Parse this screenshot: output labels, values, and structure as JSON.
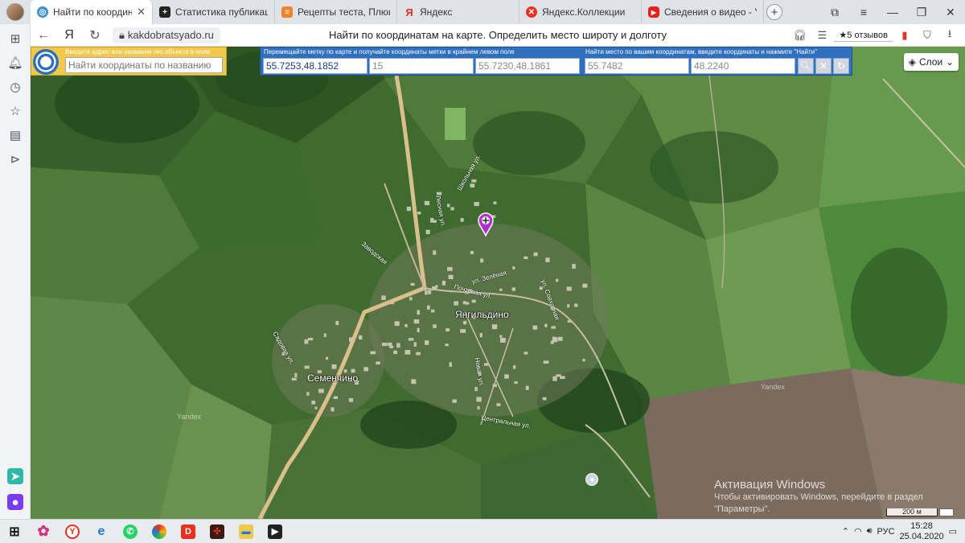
{
  "browser": {
    "tabs": [
      {
        "title": "Найти по координатам",
        "active": true,
        "favicon_color": "#3b8ed8"
      },
      {
        "title": "Статистика публикаций",
        "active": false,
        "favicon_color": "#222222"
      },
      {
        "title": "Рецепты теста, Плюшка",
        "active": false,
        "favicon_color": "#f0822a"
      },
      {
        "title": "Яндекс",
        "active": false,
        "favicon_color": "#e8321f"
      },
      {
        "title": "Яндекс.Коллекции",
        "active": false,
        "favicon_color": "#e8321f"
      },
      {
        "title": "Сведения о видео - YouT",
        "active": false,
        "favicon_color": "#e62117"
      }
    ],
    "new_tab_label": "+",
    "url": "kakdobratsyado.ru",
    "page_title": "Найти по координатам на карте. Определить место широту и долготу",
    "reviews_label": "★5 отзывов"
  },
  "search_panel": {
    "label": "Введите адрес или название гео.объекта в поле",
    "placeholder": "Найти координаты по названию"
  },
  "coord_panel": {
    "move_label": "Перемещайте метку по карте и получайте координаты метки в крайнем левом поле",
    "find_label": "Найти место по вашим координатам, введите координаты и нажмите \"Найти\"",
    "marker_coords": "55.7253,48.1852",
    "zoom": "15",
    "center_coords": "55.7230,48.1861",
    "lat_input": "55.7482",
    "lon_input": "48.2240"
  },
  "map": {
    "layers_label": "Слои",
    "villages": [
      "Янгильдино",
      "Семенчино"
    ],
    "streets": [
      "Школьная ул.",
      "Лесная ул.",
      "ул. Зелёная",
      "Заводская",
      "Почтовая ул.",
      "ул. Совхозная",
      "Садовая ул.",
      "Новая ул.",
      "Центральная ул."
    ],
    "watermark": "Yandex",
    "scale_label": "200 м"
  },
  "windows_activation": {
    "title": "Активация Windows",
    "line1": "Чтобы активировать Windows, перейдите в раздел",
    "line2": "\"Параметры\"."
  },
  "taskbar": {
    "lang": "РУС",
    "time": "15:28",
    "date": "25.04.2020"
  }
}
